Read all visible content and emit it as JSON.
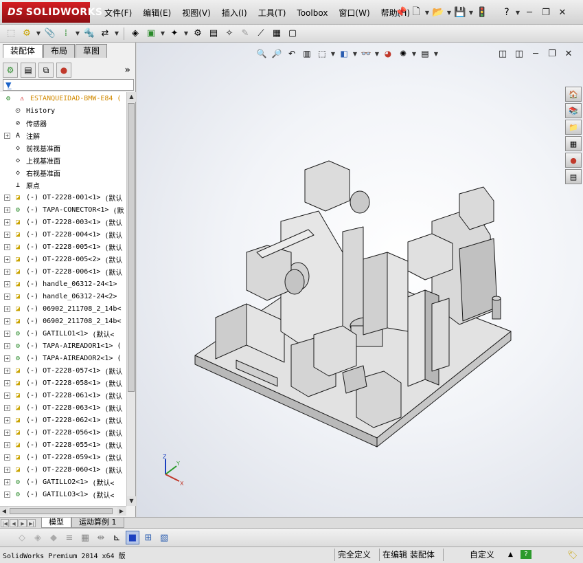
{
  "app": {
    "logo_prefix": "DS",
    "logo_text": "SOLIDWORKS",
    "brand_color": "#c8161d"
  },
  "menu": [
    "文件(F)",
    "编辑(E)",
    "视图(V)",
    "插入(I)",
    "工具(T)",
    "Toolbox",
    "窗口(W)",
    "帮助(H)"
  ],
  "left_tabs": [
    "装配体",
    "布局",
    "草图"
  ],
  "feature_tree": {
    "root": "ESTANQUEIDAD-BMW-E84",
    "root_suffix": "(",
    "fixed_items": [
      {
        "label": "History",
        "icon": "history-icon"
      },
      {
        "label": "传感器",
        "icon": "sensor-icon"
      },
      {
        "label": "注解",
        "icon": "annotation-icon"
      },
      {
        "label": "前视基准面",
        "icon": "plane-icon"
      },
      {
        "label": "上视基准面",
        "icon": "plane-icon"
      },
      {
        "label": "右视基准面",
        "icon": "plane-icon"
      },
      {
        "label": "原点",
        "icon": "origin-icon"
      }
    ],
    "components": [
      {
        "label": "(-) OT-2228-001<1>",
        "suffix": "(默认"
      },
      {
        "label": "(-) TAPA-CONECTOR<1>",
        "suffix": "(默"
      },
      {
        "label": "(-) OT-2228-003<1>",
        "suffix": "(默认"
      },
      {
        "label": "(-) OT-2228-004<1>",
        "suffix": "(默认"
      },
      {
        "label": "(-) OT-2228-005<1>",
        "suffix": "(默认"
      },
      {
        "label": "(-) OT-2228-005<2>",
        "suffix": "(默认"
      },
      {
        "label": "(-) OT-2228-006<1>",
        "suffix": "(默认"
      },
      {
        "label": "(-) handle_06312-24<1>",
        "suffix": ""
      },
      {
        "label": "(-) handle_06312-24<2>",
        "suffix": ""
      },
      {
        "label": "(-) 06902_211708_2_14b<",
        "suffix": ""
      },
      {
        "label": "(-) 06902_211708_2_14b<",
        "suffix": ""
      },
      {
        "label": "(-) GATILLO1<1>",
        "suffix": "(默认<"
      },
      {
        "label": "(-) TAPA-AIREADOR1<1>",
        "suffix": "("
      },
      {
        "label": "(-) TAPA-AIREADOR2<1>",
        "suffix": "("
      },
      {
        "label": "(-) OT-2228-057<1>",
        "suffix": "(默认"
      },
      {
        "label": "(-) OT-2228-058<1>",
        "suffix": "(默认"
      },
      {
        "label": "(-) OT-2228-061<1>",
        "suffix": "(默认"
      },
      {
        "label": "(-) OT-2228-063<1>",
        "suffix": "(默认"
      },
      {
        "label": "(-) OT-2228-062<1>",
        "suffix": "(默认"
      },
      {
        "label": "(-) OT-2228-056<1>",
        "suffix": "(默认"
      },
      {
        "label": "(-) OT-2228-055<1>",
        "suffix": "(默认"
      },
      {
        "label": "(-) OT-2228-059<1>",
        "suffix": "(默认"
      },
      {
        "label": "(-) OT-2228-060<1>",
        "suffix": "(默认"
      },
      {
        "label": "(-) GATILLO2<1>",
        "suffix": "(默认<"
      },
      {
        "label": "(-) GATILLO3<1>",
        "suffix": "(默认<"
      }
    ]
  },
  "bottom_tabs": [
    "模型",
    "运动算例 1"
  ],
  "status": {
    "app_version": "SolidWorks Premium 2014 x64 版",
    "definition": "完全定义",
    "editing": "在编辑 装配体",
    "units": "自定义"
  },
  "triad": {
    "x": "X",
    "y": "Y",
    "z": "Z"
  }
}
